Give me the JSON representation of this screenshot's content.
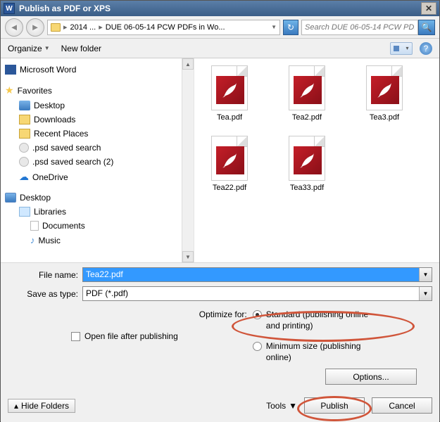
{
  "title": "Publish as PDF or XPS",
  "nav": {
    "breadcrumb_root": "2014 ...",
    "breadcrumb_folder": "DUE 06-05-14 PCW PDFs in Wo...",
    "search_placeholder": "Search DUE 06-05-14 PCW PD..."
  },
  "toolbar": {
    "organize": "Organize",
    "new_folder": "New folder"
  },
  "sidebar": {
    "word": "Microsoft Word",
    "favorites": "Favorites",
    "fav_items": [
      "Desktop",
      "Downloads",
      "Recent Places",
      ".psd saved search",
      ".psd saved search (2)",
      "OneDrive"
    ],
    "desktop": "Desktop",
    "libraries": "Libraries",
    "lib_items": [
      "Documents",
      "Music"
    ]
  },
  "files": [
    "Tea.pdf",
    "Tea2.pdf",
    "Tea3.pdf",
    "Tea22.pdf",
    "Tea33.pdf"
  ],
  "form": {
    "filename_label": "File name:",
    "filename_value": "Tea22.pdf",
    "saveas_label": "Save as type:",
    "saveas_value": "PDF (*.pdf)",
    "open_after": "Open file after publishing",
    "optimize_label": "Optimize for:",
    "radio_standard": "Standard (publishing online and printing)",
    "radio_minimum": "Minimum size (publishing online)",
    "options_btn": "Options...",
    "hide_folders": "Hide Folders",
    "tools": "Tools",
    "publish": "Publish",
    "cancel": "Cancel"
  }
}
